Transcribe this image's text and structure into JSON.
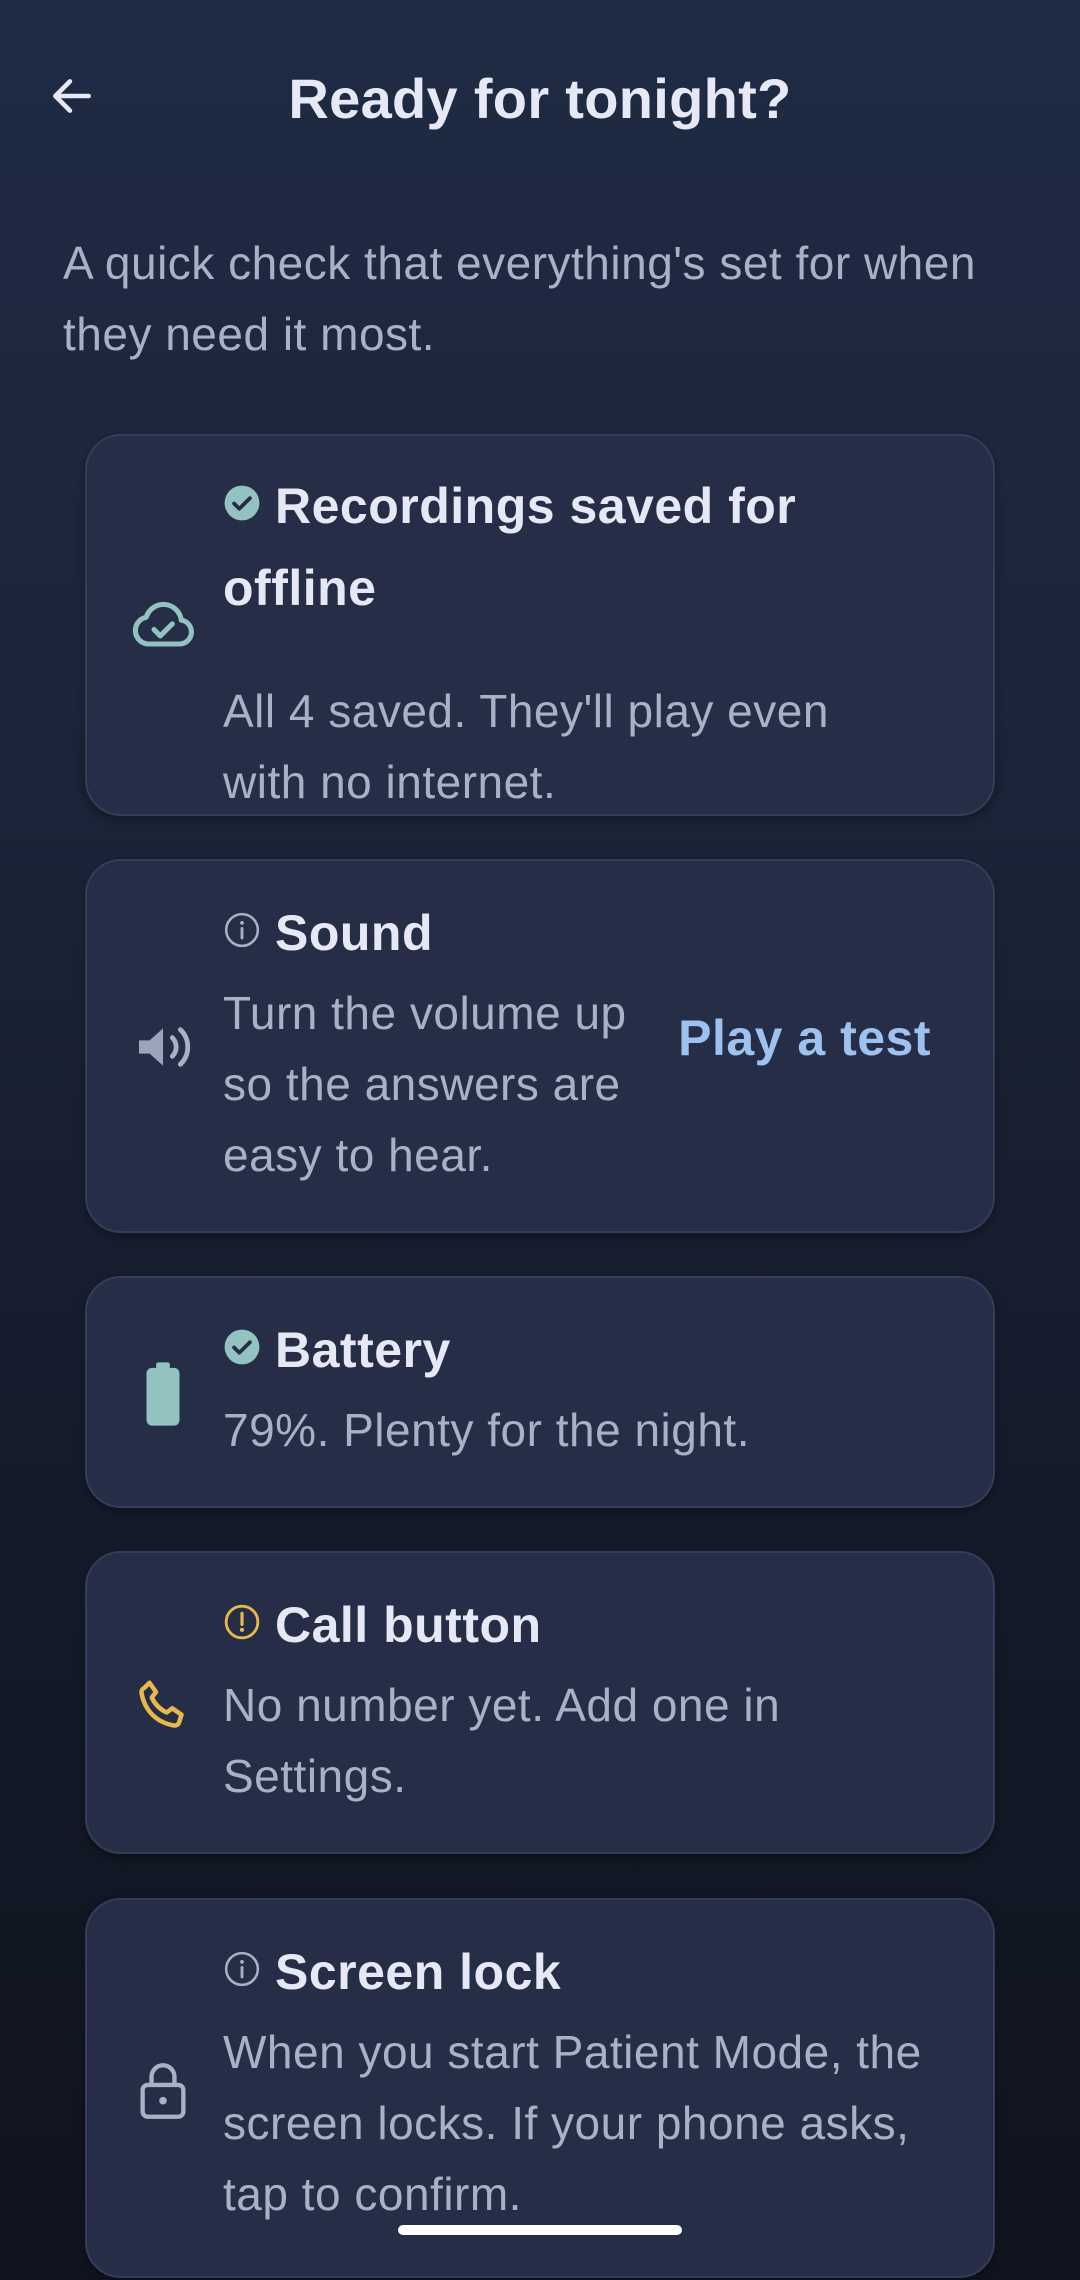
{
  "header": {
    "title": "Ready for tonight?",
    "back_icon": "arrow-left-icon"
  },
  "intro": "A quick check that everything's set for when they need it most.",
  "colors": {
    "ok": "#93c3c0",
    "warning": "#e7b94a",
    "link": "#9dc2f0",
    "card_bg": "#262e47"
  },
  "checks": [
    {
      "icon": "cloud-check-icon",
      "status": "ok",
      "status_icon": "check-circle-icon",
      "title": "Recordings saved for offline",
      "text": "All 4 saved. They'll play even with no internet."
    },
    {
      "icon": "speaker-icon",
      "status": "info",
      "status_icon": "info-circle-icon",
      "title": "Sound",
      "text": "Turn the volume up so the answers are easy to hear.",
      "action_label": "Play a test"
    },
    {
      "icon": "battery-icon",
      "status": "ok",
      "status_icon": "check-circle-icon",
      "title": "Battery",
      "text": "79%. Plenty for the night.",
      "battery_level": 0.79
    },
    {
      "icon": "phone-icon",
      "status": "warning",
      "status_icon": "alert-circle-icon",
      "title": "Call button",
      "text": "No number yet. Add one in Settings."
    },
    {
      "icon": "lock-icon",
      "status": "info",
      "status_icon": "info-circle-icon",
      "title": "Screen lock",
      "text": "When you start Patient Mode, the screen locks. If your phone asks, tap to confirm."
    }
  ]
}
